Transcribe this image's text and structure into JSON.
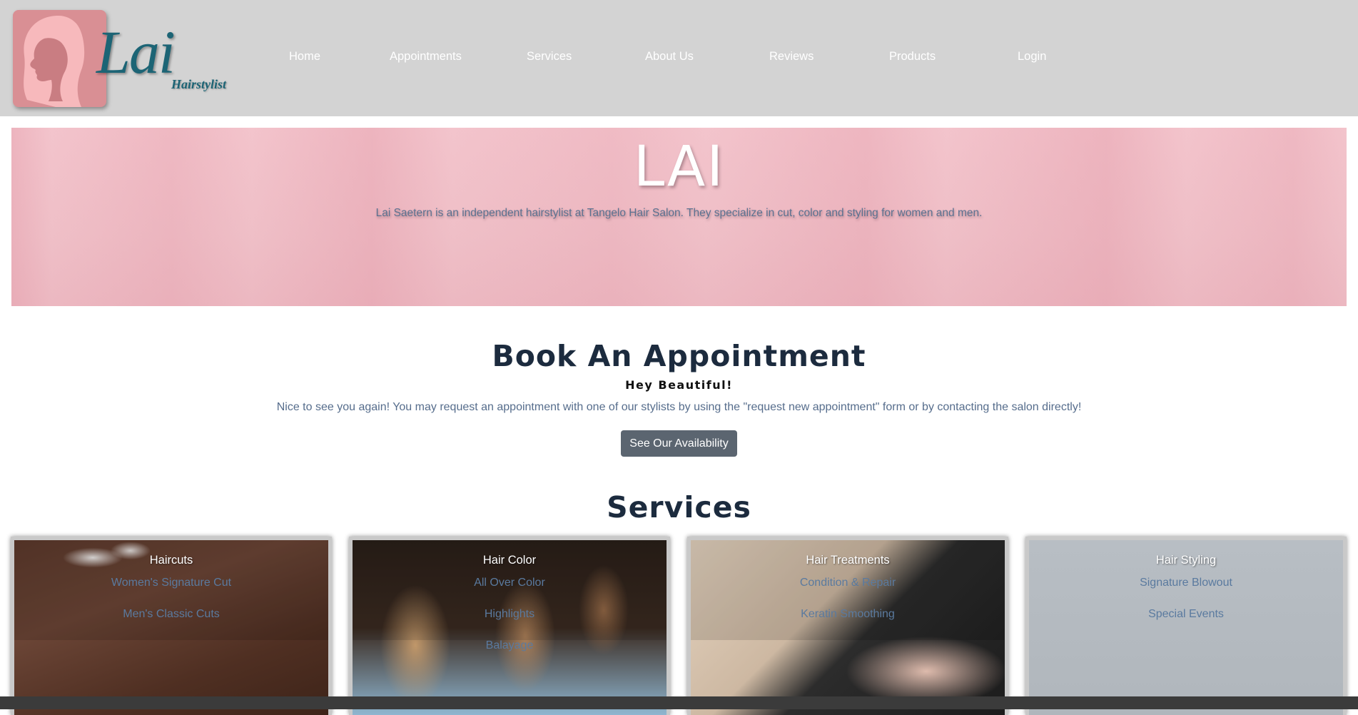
{
  "logo": {
    "script": "Lai",
    "sub": "Hairstylist"
  },
  "nav": {
    "items": [
      "Home",
      "Appointments",
      "Services",
      "About Us",
      "Reviews",
      "Products",
      "Login"
    ]
  },
  "hero": {
    "title": "LAI",
    "text": "Lai Saetern is an independent hairstylist at Tangelo Hair Salon. They specialize in cut, color and styling for women and men."
  },
  "book": {
    "title": "Book An Appointment",
    "subtitle": "Hey Beautiful!",
    "text": "Nice to see you again! You may request an appointment with one of our stylists by using the \"request new appointment\" form or by contacting the salon directly!",
    "button": "See Our Availability"
  },
  "services": {
    "title": "Services",
    "cards": [
      {
        "title": "Haircuts",
        "items": [
          "Women's Signature Cut",
          "Men's Classic Cuts"
        ]
      },
      {
        "title": "Hair Color",
        "items": [
          "All Over Color",
          "Highlights",
          "Balayage"
        ]
      },
      {
        "title": "Hair Treatments",
        "items": [
          "Condition & Repair",
          "Keratin Smoothing"
        ]
      },
      {
        "title": "Hair Styling",
        "items": [
          "Signature Blowout",
          "Special Events"
        ]
      }
    ]
  },
  "colors": {
    "nav_bg": "#d3d3d3",
    "brand_teal": "#1c6475",
    "logo_pink": "#d98f94",
    "heading": "#1c2b3e",
    "link_blue": "#566d8c",
    "button_bg": "#5b6570"
  }
}
